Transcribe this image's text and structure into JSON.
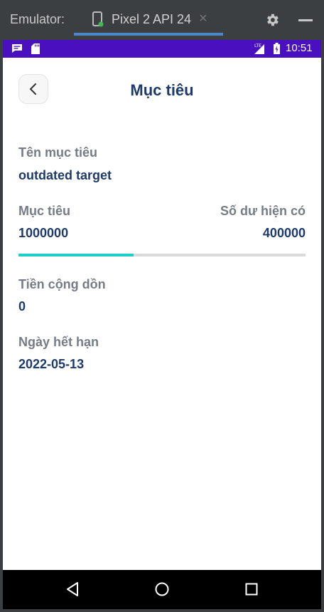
{
  "emulator": {
    "label": "Emulator:",
    "tab_title": "Pixel 2 API 24",
    "close_glyph": "×"
  },
  "status_bar": {
    "time": "10:51",
    "icons": [
      "message-icon",
      "sd-card-icon",
      "lte-signal-icon",
      "battery-charging-icon"
    ]
  },
  "header": {
    "title": "Mục tiêu",
    "back_icon": "chevron-left-icon"
  },
  "fields": {
    "name_label": "Tên mục tiêu",
    "name_value": "outdated target",
    "target_label": "Mục tiêu",
    "target_value": "1000000",
    "balance_label": "Số dư hiện có",
    "balance_value": "400000",
    "accumulated_label": "Tiền cộng dồn",
    "accumulated_value": "0",
    "due_label": "Ngày hết hạn",
    "due_value": "2022-05-13"
  },
  "progress": {
    "fraction": 0.4,
    "fill_color": "#1ecfc8",
    "track_color": "#dadada"
  },
  "nav": {
    "icons": [
      "nav-back-icon",
      "nav-home-icon",
      "nav-recent-icon"
    ]
  },
  "colors": {
    "status_bar": "#4a0fbf",
    "primary_text": "#1e3a6b",
    "label_text": "#767b86"
  }
}
